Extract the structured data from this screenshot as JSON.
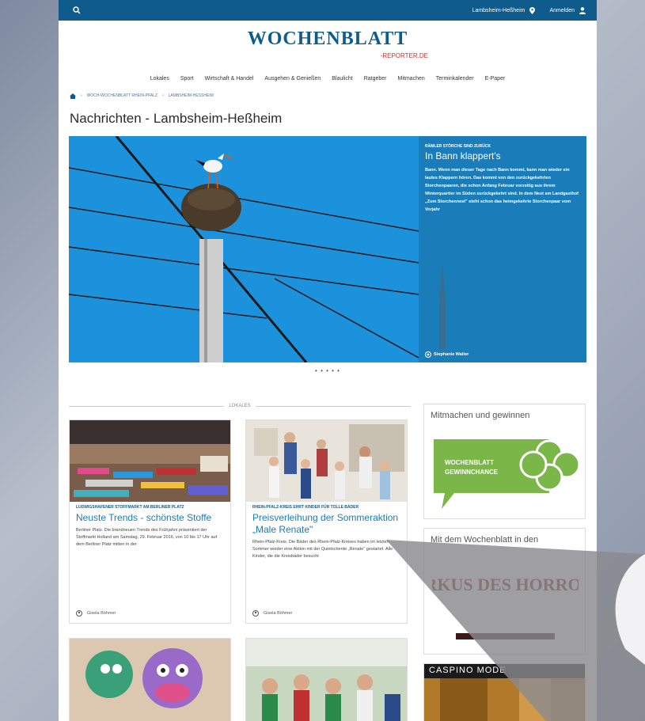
{
  "topbar": {
    "location_label": "Lambsheim-Heßheim",
    "login_label": "Anmelden"
  },
  "logo": {
    "main": "WOCHENBLATT",
    "sub": "-REPORTER.DE"
  },
  "nav": {
    "items": [
      "Lokales",
      "Sport",
      "Wirtschaft & Handel",
      "Ausgehen & Genießen",
      "Blaulicht",
      "Ratgeber",
      "Mitmachen",
      "Terminkalender",
      "E-Paper"
    ]
  },
  "breadcrumb": {
    "items": [
      "Woch-Wochenblatt Rhein-Pfalz",
      "Lambsheim-Heßheim"
    ]
  },
  "page": {
    "title": "Nachrichten - Lambsheim-Heßheim"
  },
  "hero": {
    "kicker": "Rämler Störche sind zurück",
    "headline": "In Bann klappert's",
    "text": "Bann. Wenn man dieser Tage nach Bann kommt, kann man wieder ein lautes Klappern hören. Das kommt von den zurückgekehrten Storchenpaaren, die schon Anfang Februar vorzeitig aus ihrem Winterquartier im Süden zurückgekehrt sind. In dem Nest am Landgasthof „Zum Storchennest\" steht schon das heimgekehrte Storchenpaar vom Vorjahr",
    "credit": "Stephanie Walter",
    "dots": "• • • • •"
  },
  "section": {
    "label": "LOKALES"
  },
  "cards": [
    {
      "kicker": "Ludwigshafener Stoffmarkt am Berliner Platz",
      "title": "Neuste Trends - schönste Stoffe",
      "text": "Berliner Platz. Die brandneuen Trends des Frühjahrs präsentiert der Stoffmarkt Holland am Samstag, 29. Februar 2016, von 10 bis 17 Uhr auf dem Berliner Platz mitten in der",
      "author": "Gisela Böhmer"
    },
    {
      "kicker": "Rhein-Pfalz-Kreis ehrt Kinder für tolle Bäder",
      "title": "Preisverleihung der Sommeraktion „Male Renate\"",
      "text": "Rhein-Pfalz-Kreis. Die Bäder des Rhein-Pfalz-Kreises haben im letzten Sommer wieder eine Aktion mit der Quietschente „Renate\" gestartet. Alle Kinder, die die Kreisbäder besucht",
      "author": "Gisela Böhmer"
    }
  ],
  "sidebar": {
    "box1_title": "Mitmachen und gewinnen",
    "box1_badge_line1": "WOCHENBLATT",
    "box1_badge_line2": "GEWINNCHANCE",
    "box2_title": "Mit dem Wochenblatt in den",
    "box2_logo": "ZIRKUS DES HORRORS",
    "box3_logo": "CASPINO MODE"
  },
  "colors": {
    "brand": "#0e5b8c",
    "link": "#1a7cb8",
    "green": "#7ab648"
  }
}
